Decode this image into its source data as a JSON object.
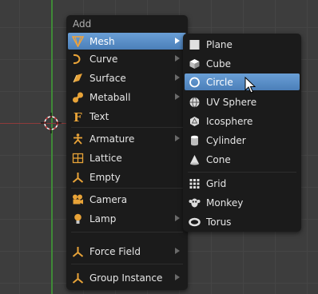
{
  "add_menu": {
    "title": "Add",
    "items": [
      {
        "label": "Mesh",
        "icon": "mesh-icon",
        "submenu": true,
        "active": true
      },
      {
        "label": "Curve",
        "icon": "curve-icon",
        "submenu": true
      },
      {
        "label": "Surface",
        "icon": "surface-icon",
        "submenu": true
      },
      {
        "label": "Metaball",
        "icon": "metaball-icon",
        "submenu": true
      },
      {
        "label": "Text",
        "icon": "text-icon",
        "submenu": false
      },
      {
        "label": "Armature",
        "icon": "armature-icon",
        "submenu": true
      },
      {
        "label": "Lattice",
        "icon": "lattice-icon",
        "submenu": false
      },
      {
        "label": "Empty",
        "icon": "empty-icon",
        "submenu": true
      },
      {
        "label": "Camera",
        "icon": "camera-icon",
        "submenu": false
      },
      {
        "label": "Lamp",
        "icon": "lamp-icon",
        "submenu": true
      },
      {
        "label": "Force Field",
        "icon": "force-field-icon",
        "submenu": true
      },
      {
        "label": "Group Instance",
        "icon": "group-instance-icon",
        "submenu": true
      }
    ]
  },
  "mesh_menu": {
    "items": [
      {
        "label": "Plane",
        "icon": "plane-icon"
      },
      {
        "label": "Cube",
        "icon": "cube-icon"
      },
      {
        "label": "Circle",
        "icon": "circle-icon",
        "active": true
      },
      {
        "label": "UV Sphere",
        "icon": "uv-sphere-icon"
      },
      {
        "label": "Icosphere",
        "icon": "icosphere-icon"
      },
      {
        "label": "Cylinder",
        "icon": "cylinder-icon"
      },
      {
        "label": "Cone",
        "icon": "cone-icon"
      },
      {
        "label": "Grid",
        "icon": "grid-icon"
      },
      {
        "label": "Monkey",
        "icon": "monkey-icon"
      },
      {
        "label": "Torus",
        "icon": "torus-icon"
      }
    ]
  },
  "colors": {
    "background": "#3d3d3d",
    "menu_background": "#1b1b1b",
    "highlight": "#5a8fcb",
    "icon_orange": "#e8a338",
    "x_axis": "#8d3b3b",
    "y_axis": "#3f8a37"
  }
}
